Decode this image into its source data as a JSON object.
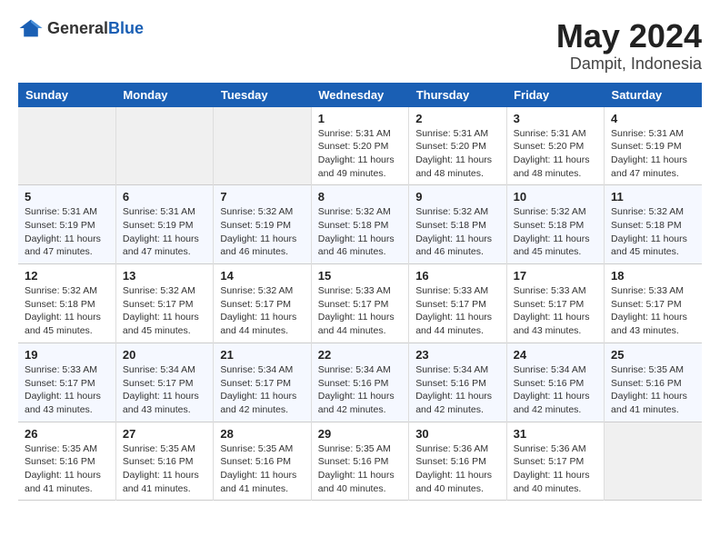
{
  "logo": {
    "general": "General",
    "blue": "Blue"
  },
  "title": {
    "month": "May 2024",
    "location": "Dampit, Indonesia"
  },
  "weekdays": [
    "Sunday",
    "Monday",
    "Tuesday",
    "Wednesday",
    "Thursday",
    "Friday",
    "Saturday"
  ],
  "weeks": [
    [
      {
        "day": "",
        "info": ""
      },
      {
        "day": "",
        "info": ""
      },
      {
        "day": "",
        "info": ""
      },
      {
        "day": "1",
        "info": "Sunrise: 5:31 AM\nSunset: 5:20 PM\nDaylight: 11 hours\nand 49 minutes."
      },
      {
        "day": "2",
        "info": "Sunrise: 5:31 AM\nSunset: 5:20 PM\nDaylight: 11 hours\nand 48 minutes."
      },
      {
        "day": "3",
        "info": "Sunrise: 5:31 AM\nSunset: 5:20 PM\nDaylight: 11 hours\nand 48 minutes."
      },
      {
        "day": "4",
        "info": "Sunrise: 5:31 AM\nSunset: 5:19 PM\nDaylight: 11 hours\nand 47 minutes."
      }
    ],
    [
      {
        "day": "5",
        "info": "Sunrise: 5:31 AM\nSunset: 5:19 PM\nDaylight: 11 hours\nand 47 minutes."
      },
      {
        "day": "6",
        "info": "Sunrise: 5:31 AM\nSunset: 5:19 PM\nDaylight: 11 hours\nand 47 minutes."
      },
      {
        "day": "7",
        "info": "Sunrise: 5:32 AM\nSunset: 5:19 PM\nDaylight: 11 hours\nand 46 minutes."
      },
      {
        "day": "8",
        "info": "Sunrise: 5:32 AM\nSunset: 5:18 PM\nDaylight: 11 hours\nand 46 minutes."
      },
      {
        "day": "9",
        "info": "Sunrise: 5:32 AM\nSunset: 5:18 PM\nDaylight: 11 hours\nand 46 minutes."
      },
      {
        "day": "10",
        "info": "Sunrise: 5:32 AM\nSunset: 5:18 PM\nDaylight: 11 hours\nand 45 minutes."
      },
      {
        "day": "11",
        "info": "Sunrise: 5:32 AM\nSunset: 5:18 PM\nDaylight: 11 hours\nand 45 minutes."
      }
    ],
    [
      {
        "day": "12",
        "info": "Sunrise: 5:32 AM\nSunset: 5:18 PM\nDaylight: 11 hours\nand 45 minutes."
      },
      {
        "day": "13",
        "info": "Sunrise: 5:32 AM\nSunset: 5:17 PM\nDaylight: 11 hours\nand 45 minutes."
      },
      {
        "day": "14",
        "info": "Sunrise: 5:32 AM\nSunset: 5:17 PM\nDaylight: 11 hours\nand 44 minutes."
      },
      {
        "day": "15",
        "info": "Sunrise: 5:33 AM\nSunset: 5:17 PM\nDaylight: 11 hours\nand 44 minutes."
      },
      {
        "day": "16",
        "info": "Sunrise: 5:33 AM\nSunset: 5:17 PM\nDaylight: 11 hours\nand 44 minutes."
      },
      {
        "day": "17",
        "info": "Sunrise: 5:33 AM\nSunset: 5:17 PM\nDaylight: 11 hours\nand 43 minutes."
      },
      {
        "day": "18",
        "info": "Sunrise: 5:33 AM\nSunset: 5:17 PM\nDaylight: 11 hours\nand 43 minutes."
      }
    ],
    [
      {
        "day": "19",
        "info": "Sunrise: 5:33 AM\nSunset: 5:17 PM\nDaylight: 11 hours\nand 43 minutes."
      },
      {
        "day": "20",
        "info": "Sunrise: 5:34 AM\nSunset: 5:17 PM\nDaylight: 11 hours\nand 43 minutes."
      },
      {
        "day": "21",
        "info": "Sunrise: 5:34 AM\nSunset: 5:17 PM\nDaylight: 11 hours\nand 42 minutes."
      },
      {
        "day": "22",
        "info": "Sunrise: 5:34 AM\nSunset: 5:16 PM\nDaylight: 11 hours\nand 42 minutes."
      },
      {
        "day": "23",
        "info": "Sunrise: 5:34 AM\nSunset: 5:16 PM\nDaylight: 11 hours\nand 42 minutes."
      },
      {
        "day": "24",
        "info": "Sunrise: 5:34 AM\nSunset: 5:16 PM\nDaylight: 11 hours\nand 42 minutes."
      },
      {
        "day": "25",
        "info": "Sunrise: 5:35 AM\nSunset: 5:16 PM\nDaylight: 11 hours\nand 41 minutes."
      }
    ],
    [
      {
        "day": "26",
        "info": "Sunrise: 5:35 AM\nSunset: 5:16 PM\nDaylight: 11 hours\nand 41 minutes."
      },
      {
        "day": "27",
        "info": "Sunrise: 5:35 AM\nSunset: 5:16 PM\nDaylight: 11 hours\nand 41 minutes."
      },
      {
        "day": "28",
        "info": "Sunrise: 5:35 AM\nSunset: 5:16 PM\nDaylight: 11 hours\nand 41 minutes."
      },
      {
        "day": "29",
        "info": "Sunrise: 5:35 AM\nSunset: 5:16 PM\nDaylight: 11 hours\nand 40 minutes."
      },
      {
        "day": "30",
        "info": "Sunrise: 5:36 AM\nSunset: 5:16 PM\nDaylight: 11 hours\nand 40 minutes."
      },
      {
        "day": "31",
        "info": "Sunrise: 5:36 AM\nSunset: 5:17 PM\nDaylight: 11 hours\nand 40 minutes."
      },
      {
        "day": "",
        "info": ""
      }
    ]
  ]
}
